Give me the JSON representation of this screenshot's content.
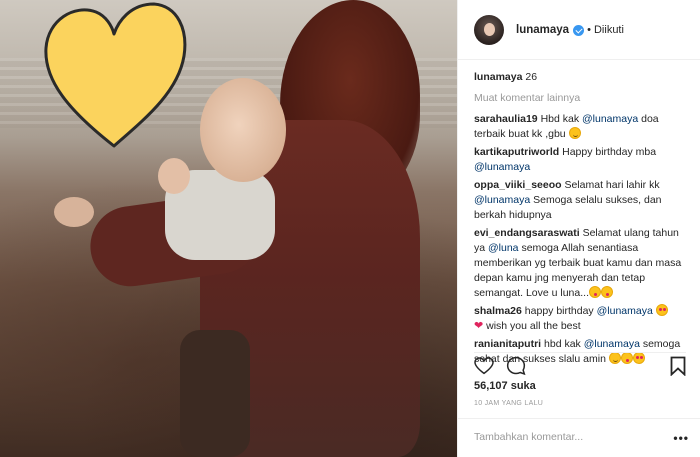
{
  "post": {
    "username": "lunamaya",
    "follow_status": "Diikuti",
    "caption_text": "26",
    "more_comments": "Muat komentar lainnya",
    "likes": "56,107 suka",
    "time": "10 JAM YANG LALU",
    "add_comment_placeholder": "Tambahkan komentar...",
    "options": "•••"
  },
  "comments": [
    {
      "user": "sarahaulia19",
      "pre": "Hbd kak ",
      "mention": "@lunamaya",
      "post": " doa terbaik buat kk ,gbu "
    },
    {
      "user": "kartikaputriworld",
      "pre": "Happy birthday mba ",
      "mention": "@lunamaya",
      "post": ""
    },
    {
      "user": "oppa_viiki_seeoo",
      "pre": "Selamat hari lahir kk ",
      "mention": "@lunamaya",
      "post": " Semoga selalu sukses, dan berkah hidupnya"
    },
    {
      "user": "evi_endangsaraswati",
      "pre": "Selamat ulang tahun ya ",
      "mention": "@luna",
      "post": " semoga Allah senantiasa memberikan yg terbaik buat kamu dan masa depan kamu jng menyerah dan tetap semangat. Love u luna..."
    },
    {
      "user": "shalma26",
      "pre": "happy birthday ",
      "mention": "@lunamaya",
      "post": " wish you all the best"
    },
    {
      "user": "ranianitaputri",
      "pre": "hbd kak ",
      "mention": "@lunamaya",
      "post": " semoga sehat dan sukses slalu amin "
    }
  ],
  "icons": {
    "like": "heart-outline-icon",
    "comment": "comment-bubble-icon",
    "save": "bookmark-icon",
    "verified": "verified-badge-icon"
  },
  "colors": {
    "heart_sticker": "#fbd35d",
    "link": "#003569",
    "verified": "#3897f0"
  }
}
